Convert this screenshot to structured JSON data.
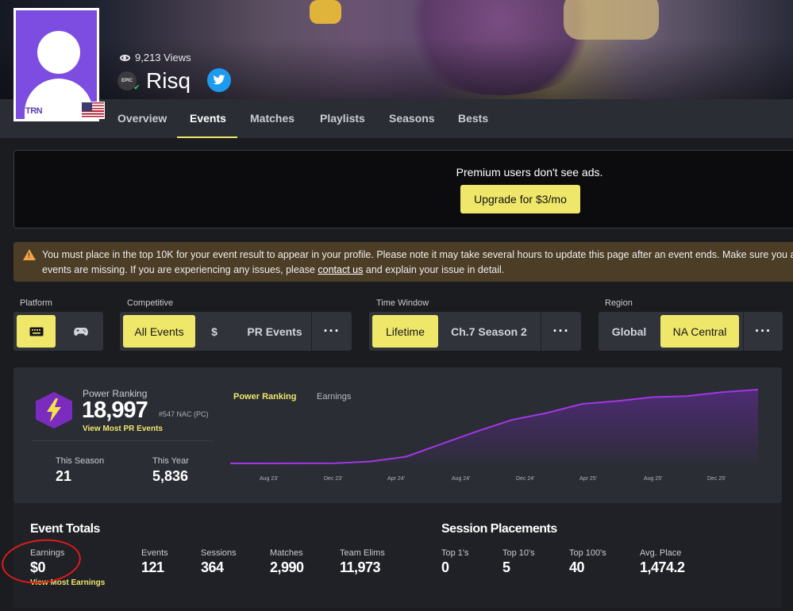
{
  "profile": {
    "views": "9,213 Views",
    "name": "Risq",
    "avatar_brand": "TRN",
    "platform_badge": "EPIC"
  },
  "tabs": [
    "Overview",
    "Events",
    "Matches",
    "Playlists",
    "Seasons",
    "Bests"
  ],
  "active_tab": "Events",
  "ad": {
    "text": "Premium users don't see ads.",
    "button": "Upgrade for $3/mo"
  },
  "warning": {
    "line1": "You must place in the top 10K for your event result to appear in your profile. Please note it may take several hours to update this page after an event ends. Make sure you a",
    "line2_before": "events are missing. If you are experiencing any issues, please ",
    "link": "contact us",
    "line2_after": " and explain your issue in detail."
  },
  "filters": {
    "platform": {
      "label": "Platform"
    },
    "competitive": {
      "label": "Competitive",
      "options": [
        "All Events",
        "$",
        "PR Events"
      ],
      "more": "···"
    },
    "time_window": {
      "label": "Time Window",
      "options": [
        "Lifetime",
        "Ch.7 Season 2"
      ],
      "more": "···"
    },
    "region": {
      "label": "Region",
      "options": [
        "Global",
        "NA Central"
      ],
      "more": "···"
    }
  },
  "power_ranking": {
    "label": "Power Ranking",
    "value": "18,997",
    "rank": "#547 NAC (PC)",
    "link": "View Most PR Events",
    "this_season_label": "This Season",
    "this_season_value": "21",
    "this_year_label": "This Year",
    "this_year_value": "5,836"
  },
  "chart_tabs": {
    "active": "Power Ranking",
    "inactive": "Earnings"
  },
  "chart_data": {
    "type": "line",
    "x": [
      "Aug 23'",
      "Dec 23'",
      "Apr 24'",
      "Aug 24'",
      "Dec 24'",
      "Apr 25'",
      "Aug 25'",
      "Dec 25'"
    ],
    "values": [
      0,
      10,
      20,
      50,
      450,
      1800,
      4900,
      8300,
      11100,
      13100,
      15200,
      16200,
      16900,
      17500,
      18200,
      18997
    ]
  },
  "event_totals": {
    "title": "Event Totals",
    "earnings_label": "Earnings",
    "earnings_value": "$0",
    "earnings_link": "View Most Earnings",
    "events_label": "Events",
    "events_value": "121",
    "sessions_label": "Sessions",
    "sessions_value": "364",
    "matches_label": "Matches",
    "matches_value": "2,990",
    "team_elims_label": "Team Elims",
    "team_elims_value": "11,973"
  },
  "session_placements": {
    "title": "Session Placements",
    "top1_label": "Top 1's",
    "top1_value": "0",
    "top10_label": "Top 10's",
    "top10_value": "5",
    "top100_label": "Top 100's",
    "top100_value": "40",
    "avg_label": "Avg. Place",
    "avg_value": "1,474.2"
  }
}
